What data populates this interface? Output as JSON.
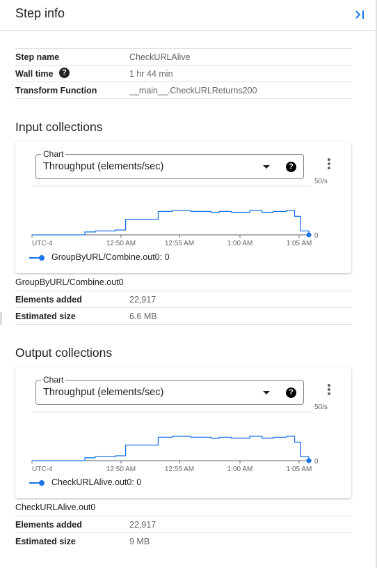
{
  "header": {
    "title": "Step info",
    "collapse_icon": "collapse-panel-icon"
  },
  "step": {
    "rows": [
      {
        "key": "Step name",
        "value": "CheckURLAlive"
      },
      {
        "key": "Wall time",
        "value": "1 hr 44 min",
        "icon": "help-icon"
      },
      {
        "key": "Transform Function",
        "value": "__main__.CheckURLReturns200"
      }
    ]
  },
  "input": {
    "title": "Input collections",
    "chart": {
      "select_label": "Chart",
      "select_value": "Throughput (elements/sec)",
      "y_max_label": "50/s",
      "y_min_label": "0",
      "x_labels": [
        "UTC-4",
        "12:50 AM",
        "12:55 AM",
        "1:00 AM",
        "1:05 AM"
      ],
      "legend": "GroupByURL/Combine.out0: 0"
    },
    "collection_name": "GroupByURL/Combine.out0",
    "rows": [
      {
        "key": "Elements added",
        "value": "22,917"
      },
      {
        "key": "Estimated size",
        "value": "6.6 MB"
      }
    ]
  },
  "output": {
    "title": "Output collections",
    "chart": {
      "select_label": "Chart",
      "select_value": "Throughput (elements/sec)",
      "y_max_label": "50/s",
      "y_min_label": "0",
      "x_labels": [
        "UTC-4",
        "12:50 AM",
        "12:55 AM",
        "1:00 AM",
        "1:05 AM"
      ],
      "legend": "CheckURLAlive.out0: 0"
    },
    "collection_name": "CheckURLAlive.out0",
    "rows": [
      {
        "key": "Elements added",
        "value": "22,917"
      },
      {
        "key": "Estimated size",
        "value": "9 MB"
      }
    ]
  },
  "chart_data": [
    {
      "type": "line",
      "ylim": [
        0,
        50
      ],
      "x_tick_labels": [
        "UTC-4",
        "12:50 AM",
        "12:55 AM",
        "1:00 AM",
        "1:05 AM"
      ],
      "series": [
        {
          "name": "GroupByURL/Combine.out0",
          "color": "#1a73e8",
          "x": [
            -4.2,
            0,
            1,
            1.6,
            2,
            3.5,
            4,
            4.8,
            5,
            7.6,
            8.2,
            9,
            9.6,
            10,
            10.6,
            11.4,
            12.2,
            13.4,
            14.2,
            14.8,
            15.4,
            16.4,
            17.2,
            17.8,
            18.4,
            19.5,
            20.2,
            20.8,
            21.3,
            21.6,
            22.2,
            22.6,
            23
          ],
          "y": [
            0,
            0,
            3,
            3,
            4,
            4,
            5,
            5,
            16,
            16,
            24,
            24,
            25,
            25,
            25,
            24,
            24,
            23,
            24,
            24,
            23,
            23,
            25,
            25,
            23,
            24,
            24,
            25,
            25,
            19,
            4,
            4,
            0
          ]
        }
      ]
    },
    {
      "type": "line",
      "ylim": [
        0,
        50
      ],
      "x_tick_labels": [
        "UTC-4",
        "12:50 AM",
        "12:55 AM",
        "1:00 AM",
        "1:05 AM"
      ],
      "series": [
        {
          "name": "CheckURLAlive.out0",
          "color": "#1a73e8",
          "x": [
            -4.2,
            0,
            1,
            1.6,
            2,
            3.5,
            4,
            4.8,
            5,
            7.6,
            8.2,
            9,
            9.6,
            10,
            10.6,
            11.4,
            12.2,
            13.4,
            14.2,
            14.8,
            15.4,
            16.4,
            17.2,
            17.8,
            18.4,
            19.5,
            20.2,
            20.8,
            21.3,
            21.6,
            22.2,
            22.6,
            23
          ],
          "y": [
            0,
            0,
            3,
            3,
            4,
            4,
            5,
            5,
            16,
            16,
            24,
            24,
            25,
            25,
            25,
            24,
            24,
            23,
            24,
            24,
            23,
            23,
            25,
            25,
            23,
            24,
            24,
            25,
            25,
            19,
            4,
            4,
            0
          ]
        }
      ]
    }
  ]
}
